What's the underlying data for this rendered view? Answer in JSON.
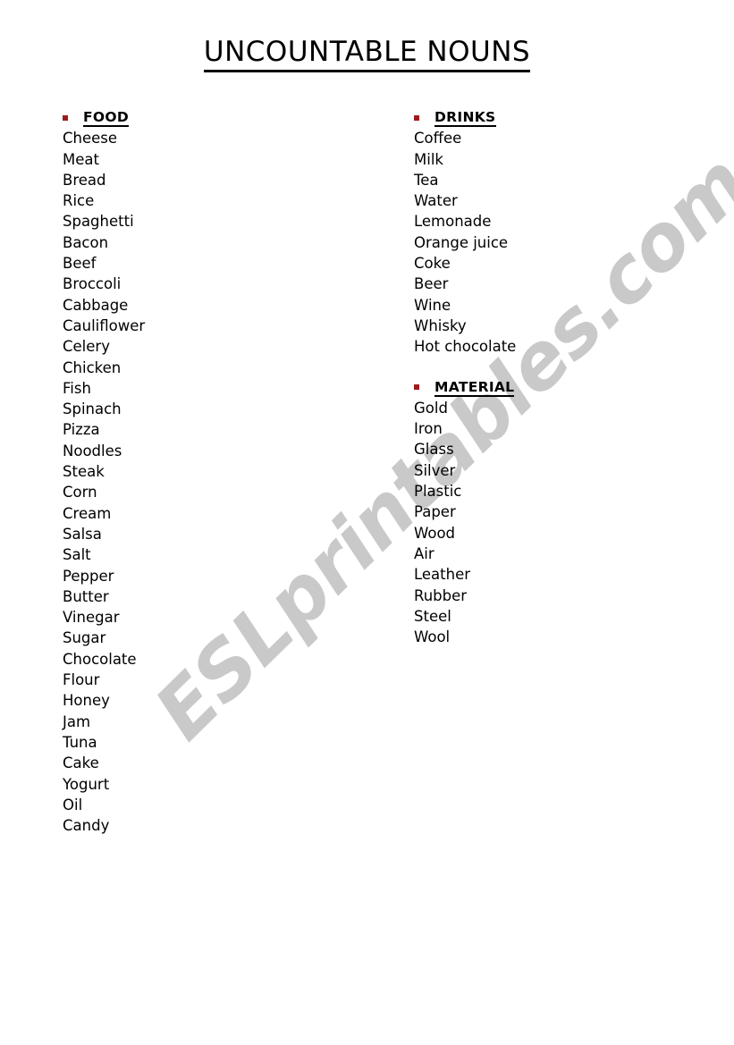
{
  "document": {
    "title": "UNCOUNTABLE NOUNS"
  },
  "watermark": {
    "text": "ESLprintables.com",
    "color": "#c9c9c9"
  },
  "style": {
    "bullet_color": "#9e1b1b",
    "text_color": "#000000",
    "page_background": "#ffffff"
  },
  "columns": [
    {
      "id": "left",
      "sections": [
        {
          "id": "food",
          "bullet": "square-bullet",
          "header": "FOOD",
          "items": [
            "Cheese",
            "Meat",
            "Bread",
            "Rice",
            "Spaghetti",
            "Bacon",
            "Beef",
            "Broccoli",
            "Cabbage",
            "Cauliflower",
            "Celery",
            "Chicken",
            "Fish",
            "Spinach",
            "Pizza",
            "Noodles",
            "Steak",
            "Corn",
            "Cream",
            "Salsa",
            "Salt",
            "Pepper",
            "Butter",
            "Vinegar",
            "Sugar",
            "Chocolate",
            "Flour",
            "Honey",
            "Jam",
            "Tuna",
            "Cake",
            "Yogurt",
            "Oil",
            "Candy"
          ]
        }
      ]
    },
    {
      "id": "right",
      "sections": [
        {
          "id": "drinks",
          "bullet": "square-bullet",
          "header": "DRINKS",
          "items": [
            "Coffee",
            "Milk",
            "Tea",
            "Water",
            "Lemonade",
            "Orange juice",
            "Coke",
            "Beer",
            "Wine",
            "Whisky",
            "Hot chocolate"
          ]
        },
        {
          "id": "material",
          "bullet": "square-bullet",
          "header": "MATERIAL",
          "items": [
            "Gold",
            "Iron",
            "Glass",
            "Silver",
            "Plastic",
            "Paper",
            "Wood",
            "Air",
            "Leather",
            "Rubber",
            "Steel",
            "Wool"
          ]
        }
      ]
    }
  ]
}
